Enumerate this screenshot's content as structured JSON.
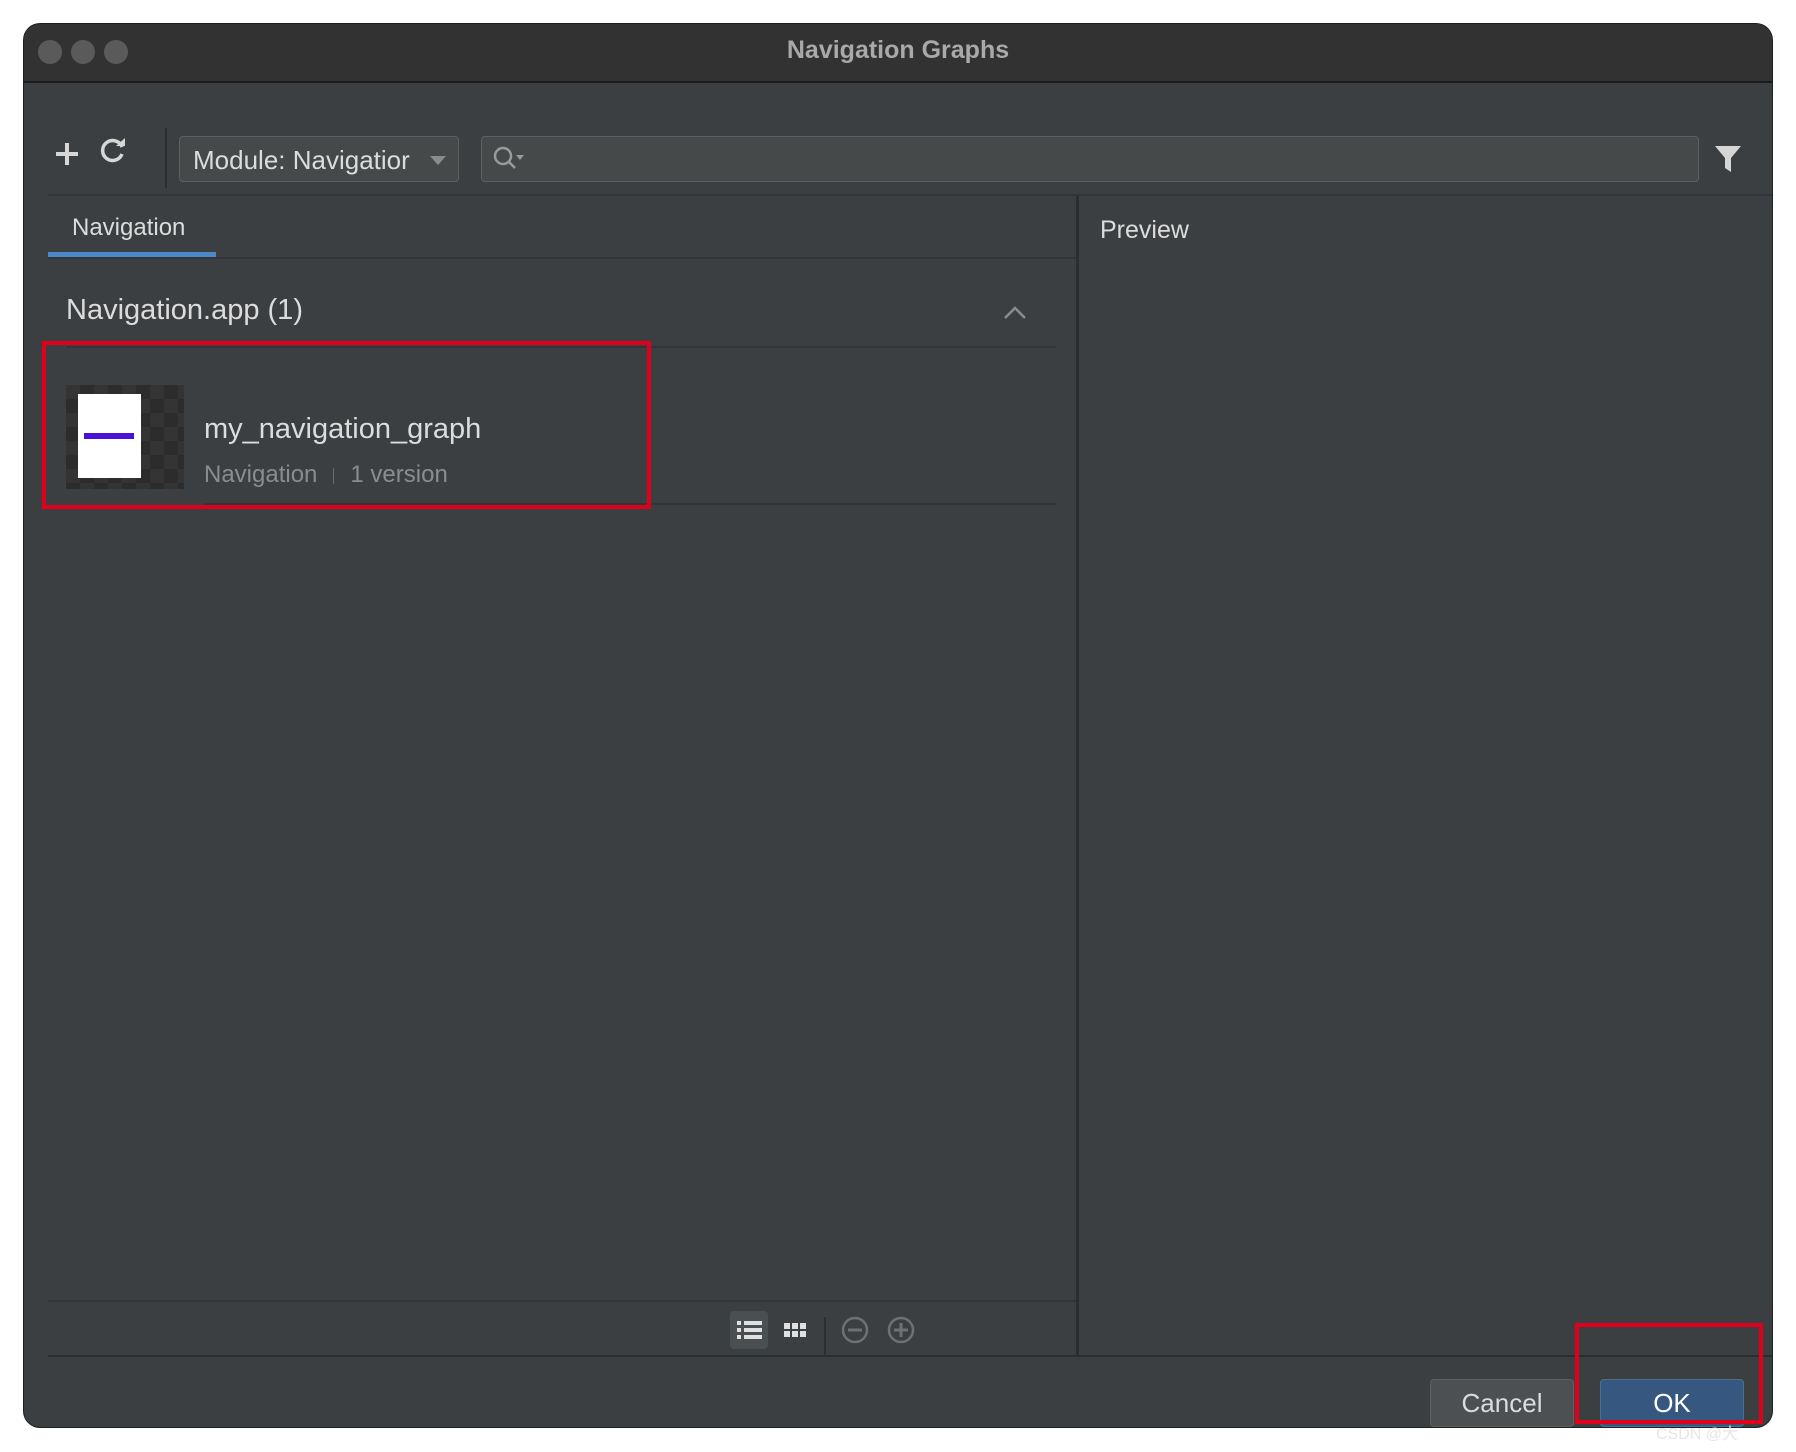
{
  "window": {
    "title": "Navigation Graphs"
  },
  "toolbar": {
    "add_icon": "plus-icon",
    "refresh_icon": "refresh-icon",
    "module_select": {
      "value": "Module: Navigatior"
    },
    "search": {
      "placeholder": "",
      "value": ""
    },
    "filter_icon": "filter-icon"
  },
  "tabs": [
    {
      "label": "Navigation",
      "active": true
    }
  ],
  "group": {
    "title": "Navigation.app (1)",
    "expanded": true
  },
  "items": [
    {
      "name": "my_navigation_graph",
      "type": "Navigation",
      "versions": "1 version"
    }
  ],
  "view_controls": {
    "list_view_icon": "list-view-icon",
    "grid_view_icon": "grid-view-icon",
    "zoom_out_icon": "zoom-out-icon",
    "zoom_in_icon": "zoom-in-icon"
  },
  "preview": {
    "title": "Preview"
  },
  "buttons": {
    "cancel": "Cancel",
    "ok": "OK"
  },
  "watermark": "CSDN @大"
}
